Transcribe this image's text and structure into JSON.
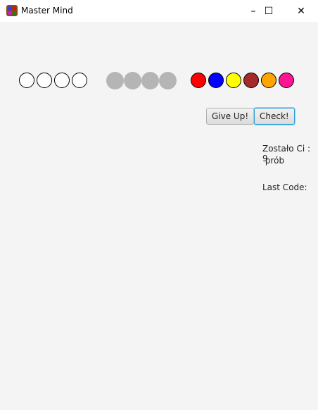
{
  "window": {
    "title": "Master Mind",
    "minimize": "–",
    "maximize": "☐",
    "close": "✕"
  },
  "guess_pegs": [
    "#ffffff",
    "#ffffff",
    "#ffffff",
    "#ffffff"
  ],
  "feedback_pegs": [
    "#b5b5b5",
    "#b5b5b5",
    "#b5b5b5",
    "#b5b5b5"
  ],
  "palette": [
    {
      "name": "red",
      "color": "#ff0000"
    },
    {
      "name": "blue",
      "color": "#0000ff"
    },
    {
      "name": "yellow",
      "color": "#ffff00"
    },
    {
      "name": "brown",
      "color": "#a52a2a"
    },
    {
      "name": "orange",
      "color": "#ffa500"
    },
    {
      "name": "pink",
      "color": "#ff1493"
    }
  ],
  "buttons": {
    "give_up": "Give Up!",
    "check": "Check!"
  },
  "status": {
    "remaining_line1": "Zostało Ci : 9",
    "remaining_line2": " prób",
    "last_code": "Last Code:"
  }
}
